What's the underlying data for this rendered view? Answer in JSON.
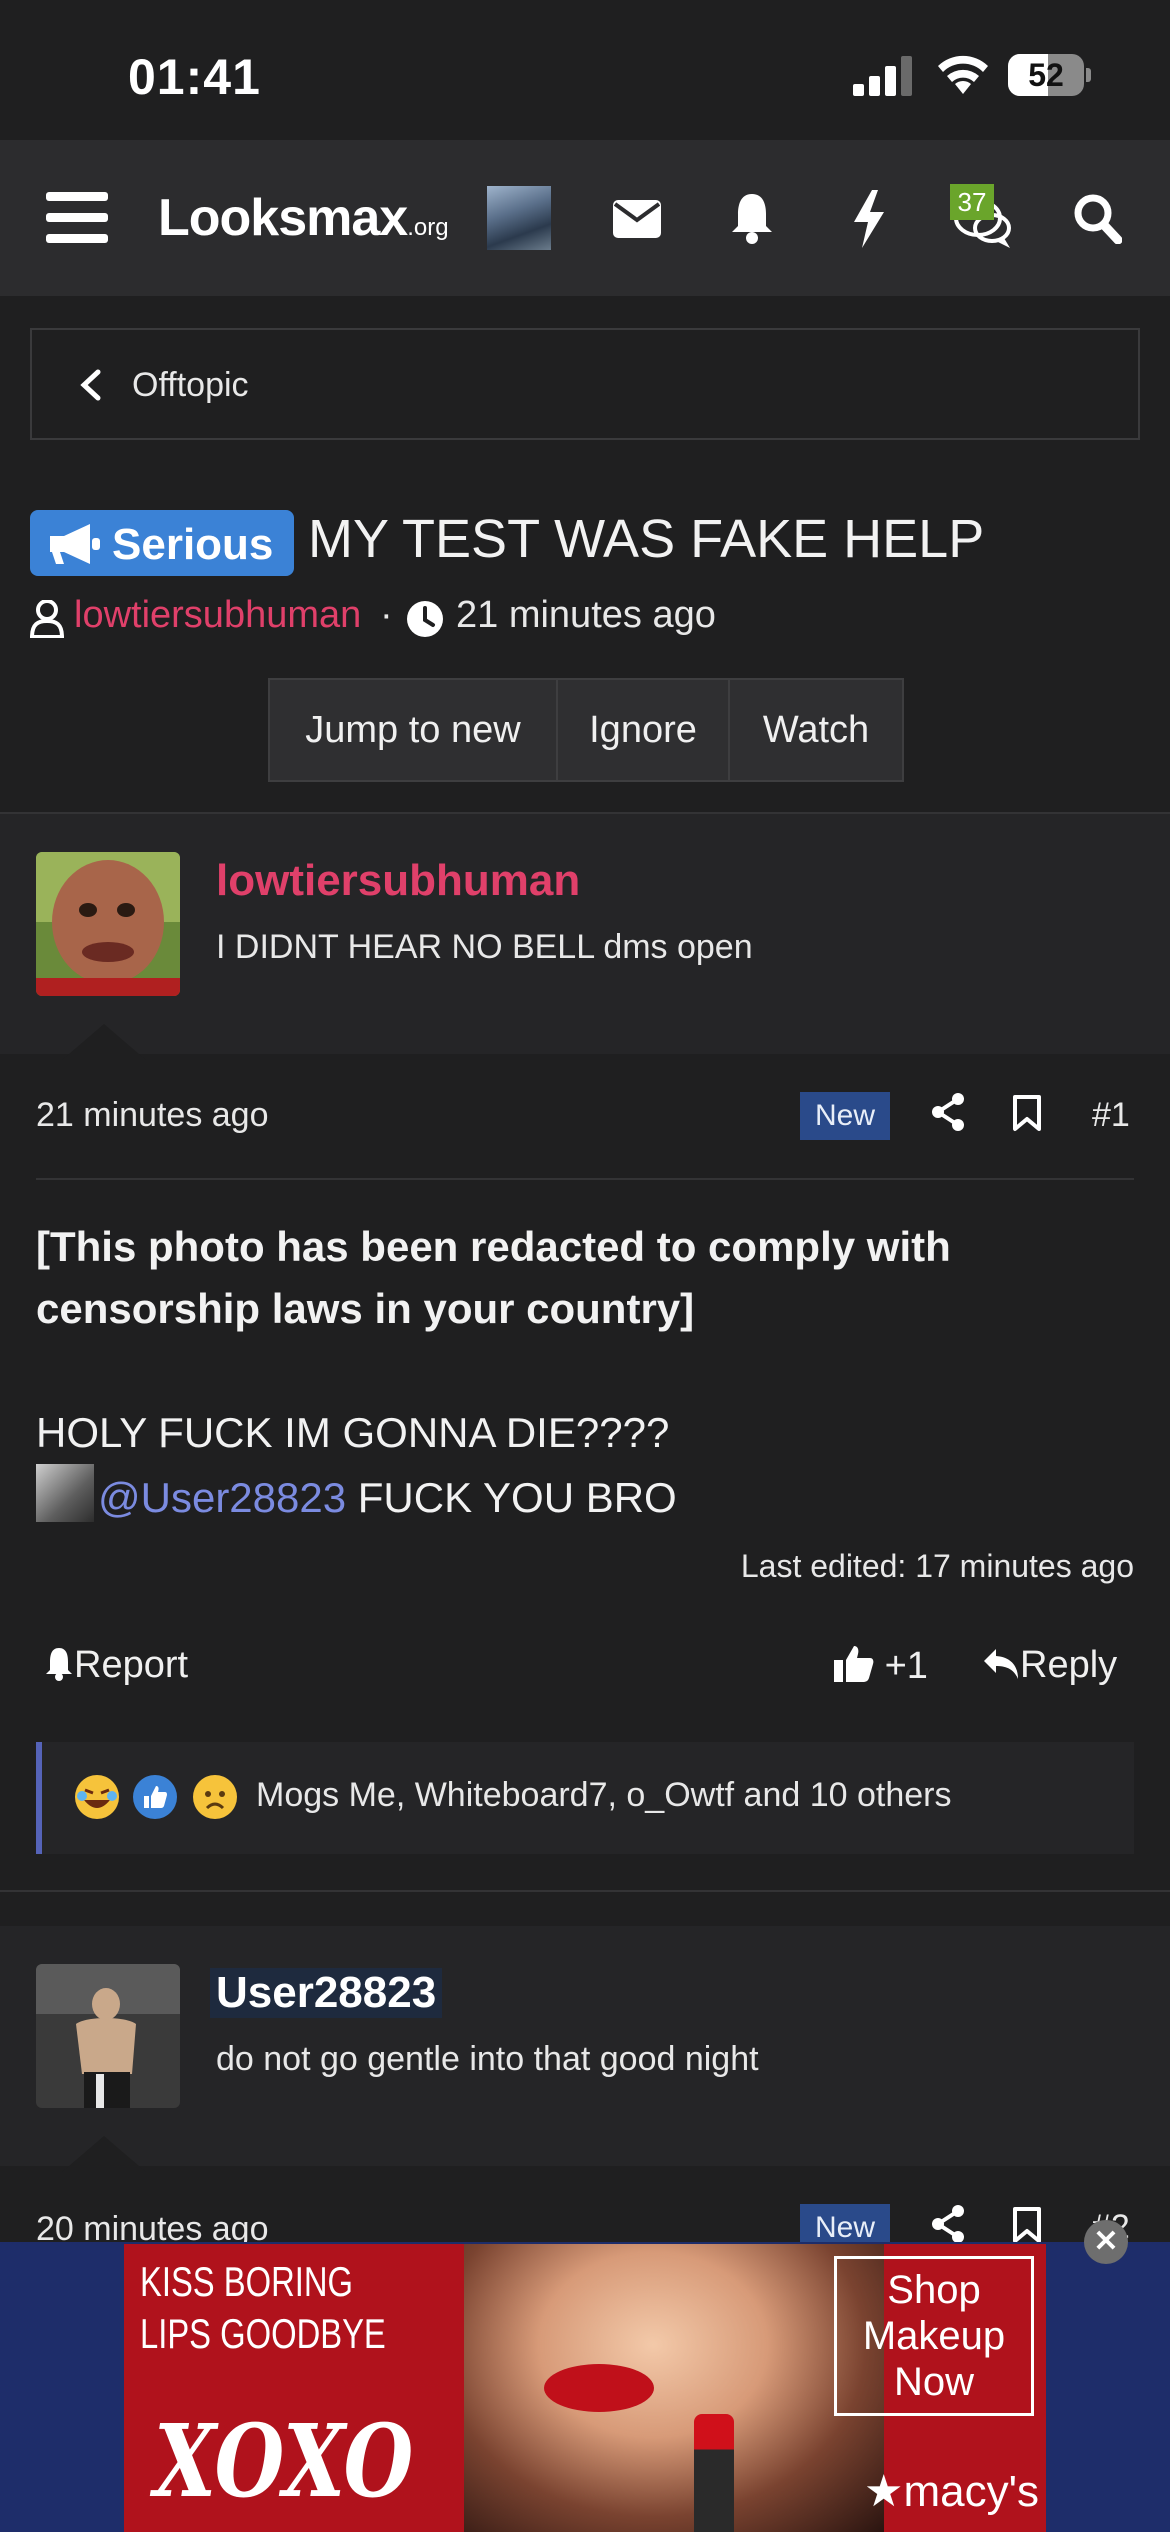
{
  "status_bar": {
    "time": "01:41",
    "battery": "52",
    "battery_level": 0.52
  },
  "navbar": {
    "logo_main": "Looksmax",
    "logo_suffix": ".org",
    "chat_count": "37"
  },
  "breadcrumb": {
    "label": "Offtopic"
  },
  "thread": {
    "prefix": "Serious",
    "title": "MY TEST WAS FAKE HELP",
    "author": "lowtiersubhuman",
    "separator": "·",
    "time": "21 minutes ago",
    "buttons": [
      "Jump to new",
      "Ignore",
      "Watch"
    ]
  },
  "posts": [
    {
      "username": "lowtiersubhuman",
      "username_color": "#e0406a",
      "user_title": "I DIDNT HEAR NO BELL dms open",
      "time": "21 minutes ago",
      "badge": "New",
      "number": "#1",
      "body_bold": "[This photo has been redacted to comply with censorship laws in your country]",
      "body_line1": "HOLY FUCK IM GONNA DIE????",
      "mention": "@User28823",
      "body_line2_rest": " FUCK YOU BRO",
      "last_edited": "Last edited: 17 minutes ago",
      "report_label": "Report",
      "like_label": "+1",
      "reply_label": "Reply",
      "reactions_text": "Mogs Me, Whiteboard7, o_Owtf and 10 others"
    },
    {
      "username": "User28823",
      "username_color": "#ffffff",
      "user_title": "do not go gentle into that good night",
      "time": "20 minutes ago",
      "badge": "New",
      "number": "#2"
    }
  ],
  "ad": {
    "line1": "KISS BORING",
    "line2": "LIPS GOODBYE",
    "xoxo": "XOXO",
    "cta": [
      "Shop",
      "Makeup",
      "Now"
    ],
    "brand": "★macy's",
    "close": "✕"
  },
  "colors": {
    "background": "#1f1f20",
    "navbar": "#2c2c2e",
    "accent_blue": "#3b82d6",
    "author_pink": "#e0406a",
    "mention_blue": "#7b8be0"
  }
}
